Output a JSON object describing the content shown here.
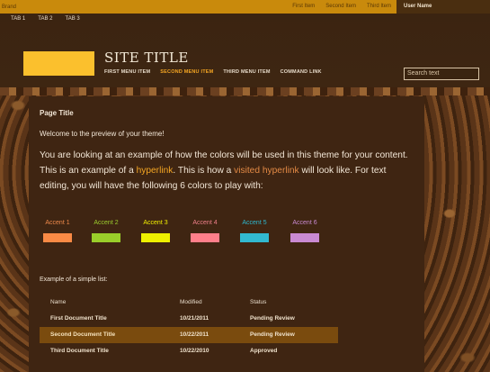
{
  "suitebar": {
    "brand": "Brand",
    "links": [
      "First Item",
      "Second Item",
      "Third Item"
    ],
    "user": "User Name"
  },
  "header": {
    "tabs": [
      "TAB 1",
      "TAB 2",
      "TAB 3"
    ],
    "site_title": "SITE TITLE",
    "nav": [
      "FIRST MENU ITEM",
      "SECOND MENU ITEM",
      "THIRD MENU ITEM",
      "COMMAND LINK"
    ],
    "search_placeholder": "Search text"
  },
  "content": {
    "page_title": "Page Title",
    "welcome": "Welcome to the preview of your theme!",
    "para_1": "You are looking at an example of how the colors will be used in this theme for your content. This is an example of a ",
    "hyperlink": "hyperlink",
    "para_2": ". This is how a ",
    "visited_hyperlink": "visited hyperlink",
    "para_3": " will look like. For text editing, you will have the following 6 colors to play with:",
    "accents": [
      {
        "label": "Accent 1",
        "color": "#f98a45",
        "label_color": "#f08a4b"
      },
      {
        "label": "Accent 2",
        "color": "#9ace2a",
        "label_color": "#9ccf2e"
      },
      {
        "label": "Accent 3",
        "color": "#eef000",
        "label_color": "#f3f000"
      },
      {
        "label": "Accent 4",
        "color": "#ff7f8a",
        "label_color": "#f0808a"
      },
      {
        "label": "Accent 5",
        "color": "#32b9d0",
        "label_color": "#2eb8cf"
      },
      {
        "label": "Accent 6",
        "color": "#c98ad2",
        "label_color": "#c98ad2"
      }
    ],
    "list_title": "Example of a simple list:",
    "list_headers": [
      "Name",
      "Modified",
      "Status"
    ],
    "list_rows": [
      [
        "First Document Title",
        "10/21/2011",
        "Pending Review"
      ],
      [
        "Second Document Title",
        "10/22/2011",
        "Pending Review"
      ],
      [
        "Third Document Title",
        "10/22/2010",
        "Approved"
      ]
    ]
  }
}
